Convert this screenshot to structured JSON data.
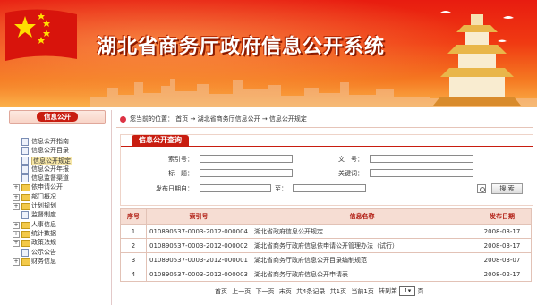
{
  "banner": {
    "title": "湖北省商务厅政府信息公开系统"
  },
  "sidebar": {
    "header": "信息公开",
    "items": [
      {
        "label": "信息公开指南",
        "icon": "document-icon",
        "expandable": false,
        "selected": false
      },
      {
        "label": "信息公开目录",
        "icon": "document-icon",
        "expandable": false,
        "selected": false
      },
      {
        "label": "信息公开规定",
        "icon": "document-icon",
        "expandable": false,
        "selected": true
      },
      {
        "label": "信息公开年报",
        "icon": "document-icon",
        "expandable": false,
        "selected": false
      },
      {
        "label": "信息监督渠道",
        "icon": "document-icon",
        "expandable": false,
        "selected": false
      },
      {
        "label": "依申请公开",
        "icon": "folder-icon",
        "expandable": true,
        "selected": false
      },
      {
        "label": "部门概况",
        "icon": "folder-icon",
        "expandable": true,
        "selected": false
      },
      {
        "label": "计划规划",
        "icon": "folder-icon",
        "expandable": true,
        "selected": false
      },
      {
        "label": "监督制度",
        "icon": "document-icon",
        "expandable": false,
        "selected": false
      },
      {
        "label": "人事信息",
        "icon": "folder-icon",
        "expandable": true,
        "selected": false
      },
      {
        "label": "统计数据",
        "icon": "folder-icon",
        "expandable": true,
        "selected": false
      },
      {
        "label": "政策法规",
        "icon": "folder-icon",
        "expandable": true,
        "selected": false
      },
      {
        "label": "公示公告",
        "icon": "document-icon",
        "expandable": false,
        "selected": false
      },
      {
        "label": "财务信息",
        "icon": "folder-icon",
        "expandable": true,
        "selected": false
      }
    ]
  },
  "breadcrumb": {
    "prefix": "您当前的位置：",
    "items": [
      "首页",
      "湖北省商务厅信息公开",
      "信息公开规定"
    ],
    "separator": "→"
  },
  "query": {
    "tab": "信息公开查询",
    "index_label": "索引号：",
    "docno_label": "文　号：",
    "title_label": "标　题：",
    "keyword_label": "关键词：",
    "date_label": "发布日期自：",
    "to_label": "至：",
    "search_button": "搜 索",
    "index_value": "",
    "docno_value": "",
    "title_value": "",
    "keyword_value": "",
    "date_from": "",
    "date_to": ""
  },
  "table": {
    "headers": [
      "序号",
      "索引号",
      "信息名称",
      "发布日期"
    ],
    "rows": [
      [
        "1",
        "010890537-0003-2012-000004",
        "湖北省政府信息公开规定",
        "2008-03-17"
      ],
      [
        "2",
        "010890537-0003-2012-000002",
        "湖北省商务厅政府信息依申请公开管理办法（试行）",
        "2008-03-17"
      ],
      [
        "3",
        "010890537-0003-2012-000001",
        "湖北省商务厅政府信息公开目录编制规范",
        "2008-03-07"
      ],
      [
        "4",
        "010890537-0003-2012-000003",
        "湖北省商务厅政府信息公开申请表",
        "2008-02-17"
      ]
    ]
  },
  "pager": {
    "first": "首页",
    "prev": "上一页",
    "next": "下一页",
    "last": "末页",
    "total": "共4条记录",
    "pages": "共1页",
    "current": "当前1页",
    "goto": "转到第",
    "page_value": "1",
    "page_unit": "页"
  },
  "colors": {
    "accent": "#c81d10",
    "banner_top": "#e81c10",
    "banner_bottom": "#fbb14a"
  }
}
